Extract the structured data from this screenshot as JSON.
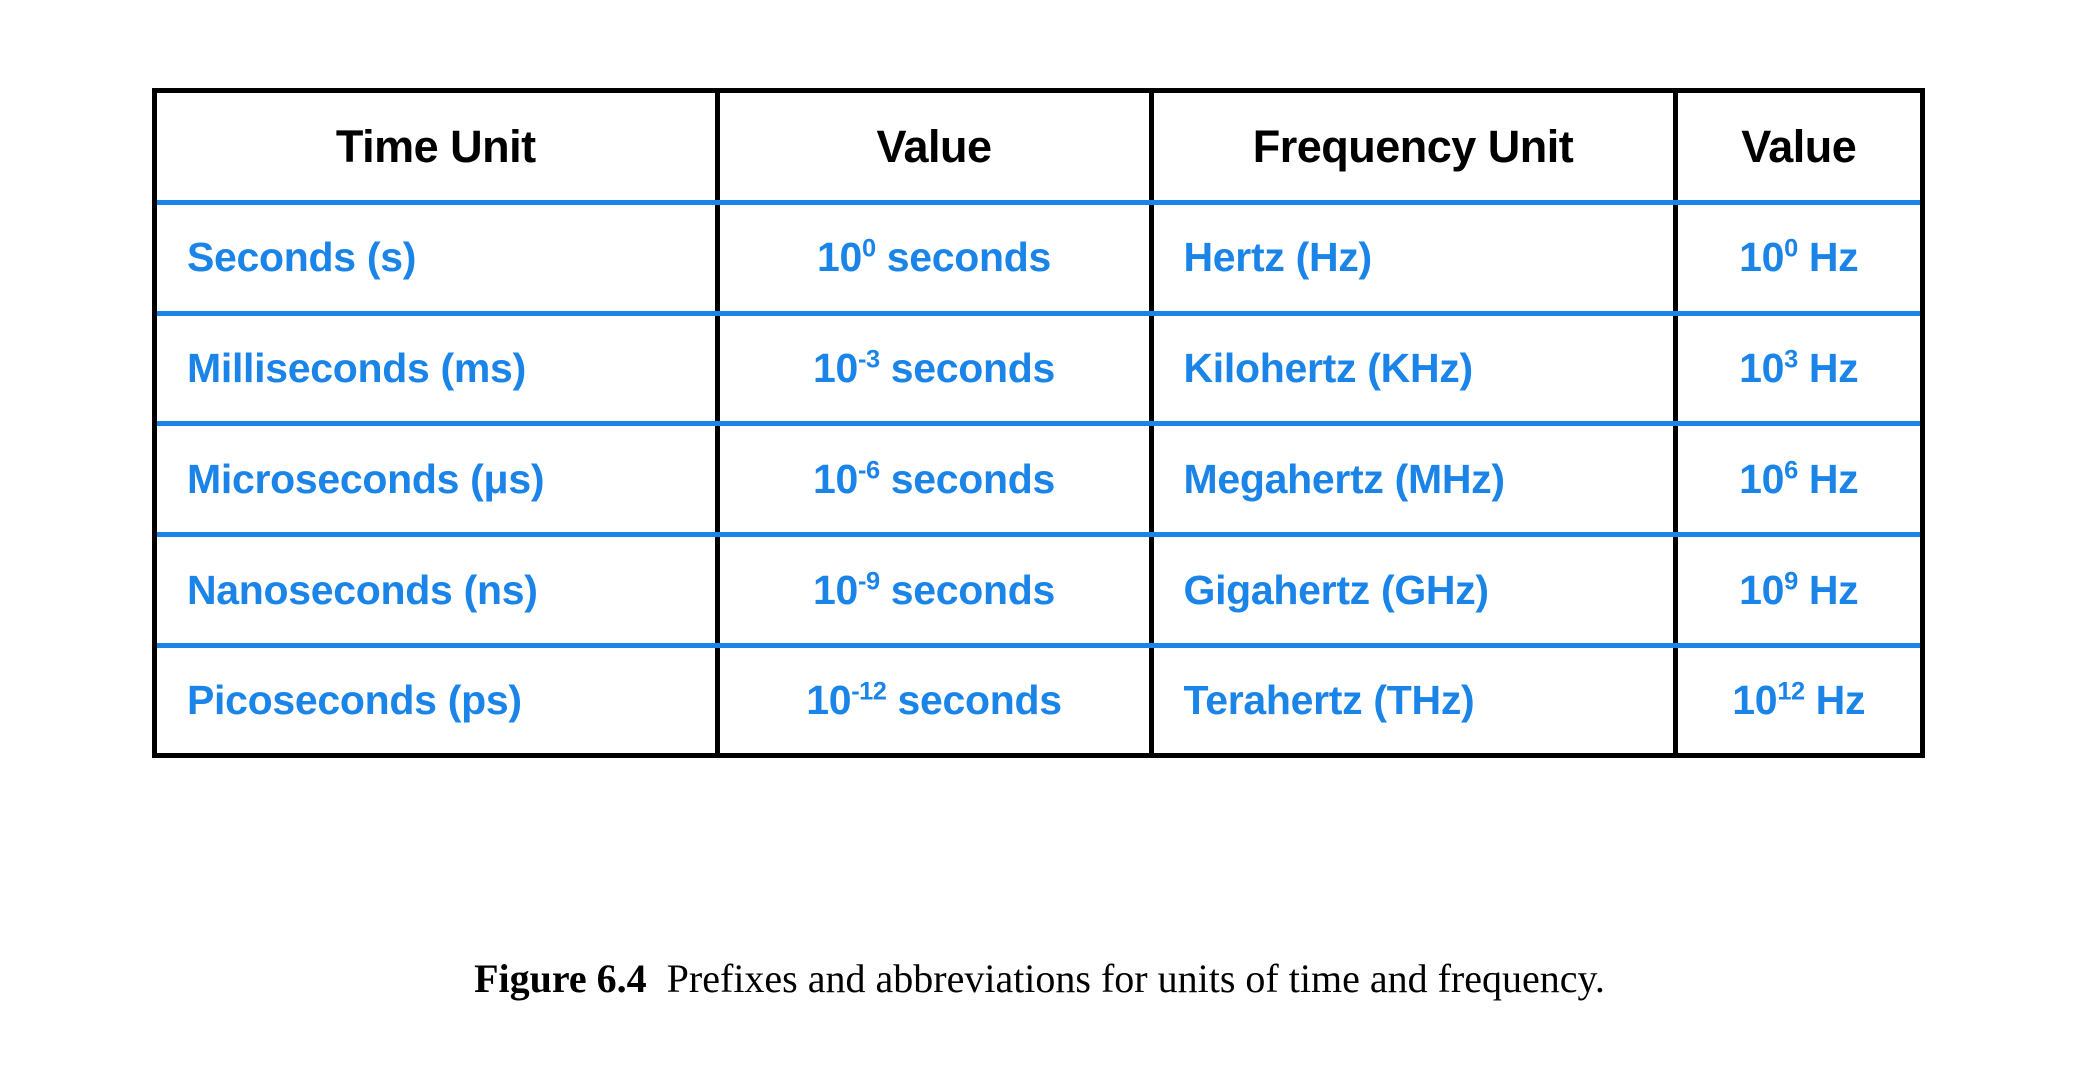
{
  "figure": {
    "caption_label": "Figure 6.4",
    "caption_text": "Prefixes and abbreviations for units of time and frequency.",
    "accent_color": "#1a84e8",
    "border_color": "#000000",
    "header_text_color": "#000000",
    "body_text_color": "#1a84e8",
    "background_color": "#ffffff"
  },
  "table": {
    "headers": [
      "Time Unit",
      "Value",
      "Frequency Unit",
      "Value"
    ],
    "rows": [
      {
        "time_unit": "Seconds (s)",
        "time_value_base": "10",
        "time_value_exponent": "0",
        "time_value_suffix": " seconds",
        "time_value_full": "10⁰ seconds",
        "frequency_unit": "Hertz (Hz)",
        "frequency_value_base": "10",
        "frequency_value_exponent": "0",
        "frequency_value_suffix": " Hz",
        "frequency_value_full": "10⁰ Hz"
      },
      {
        "time_unit": "Milliseconds (ms)",
        "time_value_base": "10",
        "time_value_exponent": "-3",
        "time_value_suffix": " seconds",
        "time_value_full": "10⁻³ seconds",
        "frequency_unit": "Kilohertz (KHz)",
        "frequency_value_base": "10",
        "frequency_value_exponent": "3",
        "frequency_value_suffix": " Hz",
        "frequency_value_full": "10³ Hz"
      },
      {
        "time_unit": "Microseconds (μs)",
        "time_value_base": "10",
        "time_value_exponent": "-6",
        "time_value_suffix": " seconds",
        "time_value_full": "10⁻⁶ seconds",
        "frequency_unit": "Megahertz (MHz)",
        "frequency_value_base": "10",
        "frequency_value_exponent": "6",
        "frequency_value_suffix": " Hz",
        "frequency_value_full": "10⁶ Hz"
      },
      {
        "time_unit": "Nanoseconds (ns)",
        "time_value_base": "10",
        "time_value_exponent": "-9",
        "time_value_suffix": " seconds",
        "time_value_full": "10⁻⁹ seconds",
        "frequency_unit": "Gigahertz (GHz)",
        "frequency_value_base": "10",
        "frequency_value_exponent": "9",
        "frequency_value_suffix": " Hz",
        "frequency_value_full": "10⁹ Hz"
      },
      {
        "time_unit": "Picoseconds (ps)",
        "time_value_base": "10",
        "time_value_exponent": "-12",
        "time_value_suffix": " seconds",
        "time_value_full": "10⁻¹² seconds",
        "frequency_unit": "Terahertz (THz)",
        "frequency_value_base": "10",
        "frequency_value_exponent": "12",
        "frequency_value_suffix": " Hz",
        "frequency_value_full": "10¹² Hz"
      }
    ]
  }
}
